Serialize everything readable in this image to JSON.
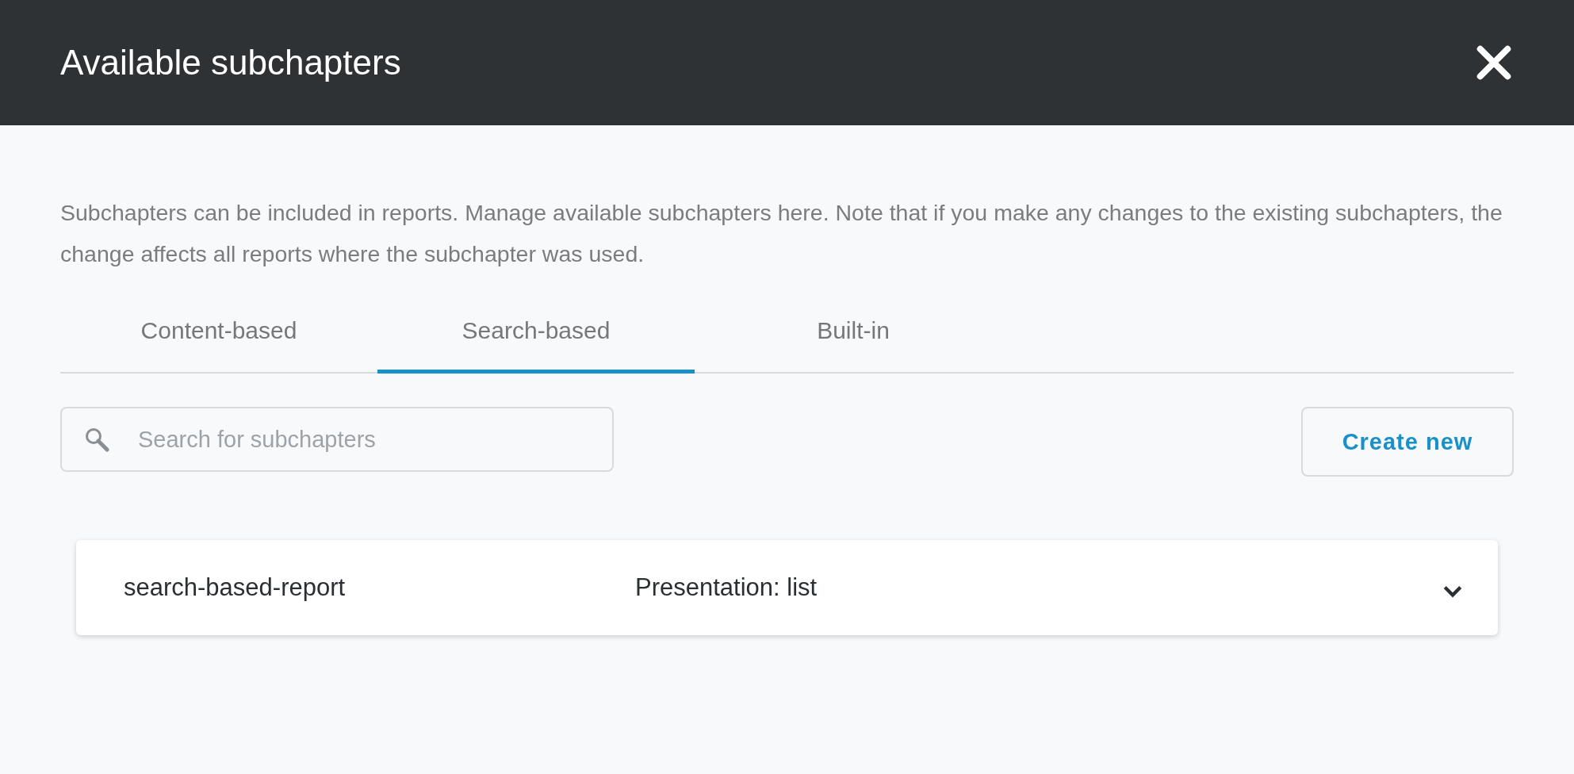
{
  "dialog": {
    "title": "Available subchapters"
  },
  "description": "Subchapters can be included in reports. Manage available subchapters here. Note that if you make any changes to the existing subchapters, the change affects all reports where the subchapter was used.",
  "tabs": [
    {
      "label": "Content-based",
      "selected": false
    },
    {
      "label": "Search-based",
      "selected": true
    },
    {
      "label": "Built-in",
      "selected": false
    }
  ],
  "search": {
    "placeholder": "Search for subchapters"
  },
  "create_button": "Create new",
  "subchapters": [
    {
      "name": "search-based-report",
      "presentation": "Presentation: list",
      "expanded": false
    }
  ]
}
